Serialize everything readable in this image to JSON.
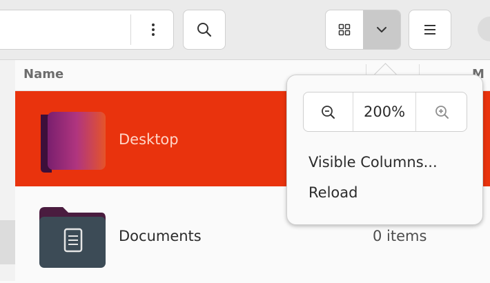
{
  "list": {
    "columns": {
      "name": "Name",
      "modified_partial": "M"
    },
    "rows": [
      {
        "name": "Desktop",
        "size": "",
        "selected": true
      },
      {
        "name": "Documents",
        "size": "0 items",
        "selected": false
      }
    ]
  },
  "popover": {
    "zoom_level": "200%",
    "items": [
      "Visible Columns...",
      "Reload"
    ]
  },
  "icons": {
    "path_menu": "vertical-dots-icon",
    "search": "search-icon",
    "grid_view": "grid-view-icon",
    "dropdown": "chevron-down-icon",
    "list_menu": "hamburger-menu-icon",
    "zoom_out": "zoom-out-icon",
    "zoom_in": "zoom-in-icon"
  },
  "colors": {
    "selection": "#e9330d",
    "selection_text": "#ffd5c7"
  }
}
